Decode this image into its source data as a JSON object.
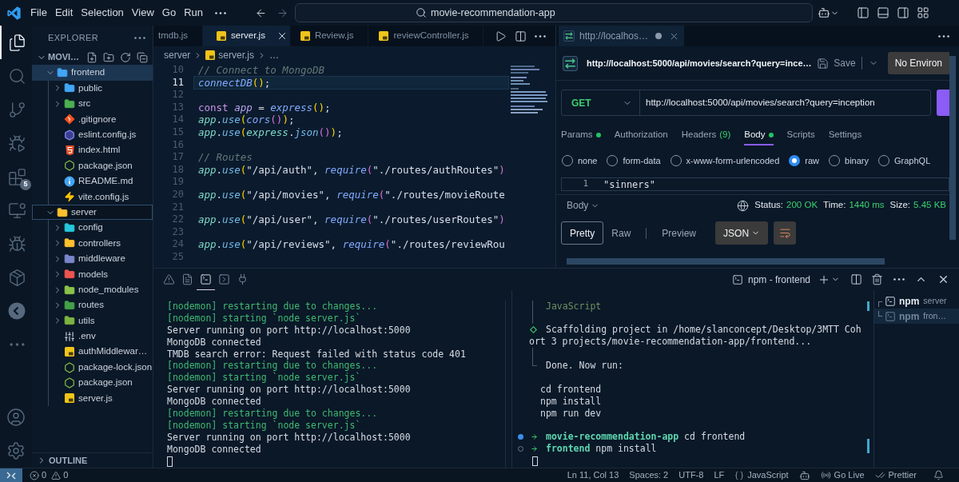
{
  "title_bar": {
    "menu": [
      "File",
      "Edit",
      "Selection",
      "View",
      "Go",
      "Run"
    ],
    "search": "movie-recommendation-app"
  },
  "activity_bar": {
    "items": [
      {
        "kind": "explorer",
        "selected": true
      },
      {
        "kind": "search",
        "selected": false
      },
      {
        "kind": "git",
        "selected": false
      },
      {
        "kind": "debug",
        "selected": false
      },
      {
        "kind": "extensions",
        "selected": false,
        "badge": "5"
      },
      {
        "kind": "remote",
        "selected": false
      },
      {
        "kind": "testing",
        "selected": false
      },
      {
        "kind": "docker",
        "selected": false
      },
      {
        "kind": "thunder",
        "selected": false
      },
      {
        "kind": "more",
        "selected": false
      }
    ]
  },
  "explorer": {
    "title": "EXPLORER",
    "workspace": {
      "label": "MOVI…",
      "expanded": true
    },
    "tree": [
      {
        "kind": "folder",
        "label": "frontend",
        "color": "#42a5f5",
        "expanded": true,
        "selected": true,
        "focused": false,
        "children": [
          {
            "kind": "folder",
            "label": "public",
            "color": "#42a5f5",
            "expanded": false,
            "selected": false
          },
          {
            "kind": "folder",
            "label": "src",
            "color": "#4caf50",
            "expanded": false,
            "selected": false
          },
          {
            "kind": "git",
            "label": ".gitignore",
            "selected": false
          },
          {
            "kind": "eslint",
            "label": "eslint.config.js",
            "selected": false
          },
          {
            "kind": "html",
            "label": "index.html",
            "selected": false
          },
          {
            "kind": "json",
            "label": "package.json",
            "selected": false
          },
          {
            "kind": "info",
            "label": "README.md",
            "selected": false
          },
          {
            "kind": "vite",
            "label": "vite.config.js",
            "selected": false
          }
        ]
      },
      {
        "kind": "folder",
        "label": "server",
        "color": "#fbc02d",
        "expanded": true,
        "selected": false,
        "focused": true,
        "children": [
          {
            "kind": "folder",
            "label": "config",
            "color": "#26c6da",
            "expanded": false,
            "selected": false
          },
          {
            "kind": "folder",
            "label": "controllers",
            "color": "#fbc02d",
            "expanded": false,
            "selected": false
          },
          {
            "kind": "folder",
            "label": "middleware",
            "color": "#7986cb",
            "expanded": false,
            "selected": false
          },
          {
            "kind": "folder",
            "label": "models",
            "color": "#ef5350",
            "expanded": false,
            "selected": false
          },
          {
            "kind": "folder",
            "label": "node_modules",
            "color": "#8bc34a",
            "expanded": false,
            "selected": false
          },
          {
            "kind": "folder",
            "label": "routes",
            "color": "#43a047",
            "expanded": false,
            "selected": false
          },
          {
            "kind": "folder",
            "label": "utils",
            "color": "#7cb342",
            "expanded": false,
            "selected": false
          },
          {
            "kind": "env",
            "label": ".env",
            "selected": false
          },
          {
            "kind": "js",
            "label": "authMiddlewar…",
            "selected": false
          },
          {
            "kind": "json",
            "label": "package-lock.json",
            "selected": false
          },
          {
            "kind": "json",
            "label": "package.json",
            "selected": false
          },
          {
            "kind": "js",
            "label": "server.js",
            "selected": false
          }
        ]
      }
    ],
    "outline": {
      "label": "OUTLINE",
      "expanded": false
    }
  },
  "editor": {
    "tabs": [
      {
        "label": "tmdb.js",
        "icon": false,
        "selected": false
      },
      {
        "label": "server.js",
        "icon": true,
        "selected": true
      },
      {
        "label": "Review.js",
        "icon": true,
        "selected": false
      },
      {
        "label": "reviewController.js",
        "icon": true,
        "selected": false
      }
    ],
    "breadcrumbs": [
      {
        "label": "server",
        "icon": false
      },
      {
        "label": "server.js",
        "icon": true
      },
      {
        "label": "…",
        "icon": false
      }
    ],
    "lines": [
      {
        "number": "10",
        "current": false,
        "tokens": [
          {
            "kind": "comment",
            "text": "// Connect to MongoDB"
          }
        ]
      },
      {
        "number": "11",
        "current": true,
        "tokens": [
          {
            "kind": "function",
            "text": "connectDB"
          },
          {
            "kind": "bracket1",
            "text": "()"
          },
          {
            "kind": "punct",
            "text": ";"
          }
        ]
      },
      {
        "number": "12",
        "current": false
      },
      {
        "number": "13",
        "current": false,
        "tokens": [
          {
            "kind": "keyword",
            "text": "const "
          },
          {
            "kind": "decl",
            "text": "app"
          },
          {
            "kind": "punct",
            "text": " = "
          },
          {
            "kind": "function",
            "text": "express"
          },
          {
            "kind": "bracket1",
            "text": "()"
          },
          {
            "kind": "punct",
            "text": ";"
          }
        ]
      },
      {
        "number": "14",
        "current": false,
        "tokens": [
          {
            "kind": "variable",
            "text": "app"
          },
          {
            "kind": "punct",
            "text": "."
          },
          {
            "kind": "method",
            "text": "use"
          },
          {
            "kind": "bracket1",
            "text": "("
          },
          {
            "kind": "function",
            "text": "cors"
          },
          {
            "kind": "bracket2",
            "text": "()"
          },
          {
            "kind": "bracket1",
            "text": ")"
          },
          {
            "kind": "punct",
            "text": ";"
          }
        ]
      },
      {
        "number": "15",
        "current": false,
        "tokens": [
          {
            "kind": "variable",
            "text": "app"
          },
          {
            "kind": "punct",
            "text": "."
          },
          {
            "kind": "method",
            "text": "use"
          },
          {
            "kind": "bracket1",
            "text": "("
          },
          {
            "kind": "variable",
            "text": "express"
          },
          {
            "kind": "punct",
            "text": "."
          },
          {
            "kind": "method",
            "text": "json"
          },
          {
            "kind": "bracket2",
            "text": "()"
          },
          {
            "kind": "bracket1",
            "text": ")"
          },
          {
            "kind": "punct",
            "text": ";"
          }
        ]
      },
      {
        "number": "16",
        "current": false
      },
      {
        "number": "17",
        "current": false,
        "tokens": [
          {
            "kind": "comment",
            "text": "// Routes"
          }
        ]
      },
      {
        "number": "18",
        "current": false,
        "tokens": [
          {
            "kind": "variable",
            "text": "app"
          },
          {
            "kind": "punct",
            "text": "."
          },
          {
            "kind": "method",
            "text": "use"
          },
          {
            "kind": "bracket1",
            "text": "("
          },
          {
            "kind": "string",
            "text": "\"/api/auth\""
          },
          {
            "kind": "punct",
            "text": ", "
          },
          {
            "kind": "function",
            "text": "require"
          },
          {
            "kind": "bracket2",
            "text": "("
          },
          {
            "kind": "string",
            "text": "\"./routes/authRoutes\""
          },
          {
            "kind": "bracket2",
            "text": ")"
          }
        ]
      },
      {
        "number": "19",
        "current": false
      },
      {
        "number": "20",
        "current": false,
        "tokens": [
          {
            "kind": "variable",
            "text": "app"
          },
          {
            "kind": "punct",
            "text": "."
          },
          {
            "kind": "method",
            "text": "use"
          },
          {
            "kind": "bracket1",
            "text": "("
          },
          {
            "kind": "string",
            "text": "\"/api/movies\""
          },
          {
            "kind": "punct",
            "text": ", "
          },
          {
            "kind": "function",
            "text": "require"
          },
          {
            "kind": "bracket2",
            "text": "("
          },
          {
            "kind": "string",
            "text": "\"./routes/movieRoute"
          }
        ]
      },
      {
        "number": "21",
        "current": false
      },
      {
        "number": "22",
        "current": false,
        "tokens": [
          {
            "kind": "variable",
            "text": "app"
          },
          {
            "kind": "punct",
            "text": "."
          },
          {
            "kind": "method",
            "text": "use"
          },
          {
            "kind": "bracket1",
            "text": "("
          },
          {
            "kind": "string",
            "text": "\"/api/user\""
          },
          {
            "kind": "punct",
            "text": ", "
          },
          {
            "kind": "function",
            "text": "require"
          },
          {
            "kind": "bracket2",
            "text": "("
          },
          {
            "kind": "string",
            "text": "\"./routes/userRoutes\""
          },
          {
            "kind": "bracket2",
            "text": ")"
          }
        ]
      },
      {
        "number": "23",
        "current": false
      },
      {
        "number": "24",
        "current": false,
        "tokens": [
          {
            "kind": "variable",
            "text": "app"
          },
          {
            "kind": "punct",
            "text": "."
          },
          {
            "kind": "method",
            "text": "use"
          },
          {
            "kind": "bracket1",
            "text": "("
          },
          {
            "kind": "string",
            "text": "\"/api/reviews\""
          },
          {
            "kind": "punct",
            "text": ", "
          },
          {
            "kind": "function",
            "text": "require"
          },
          {
            "kind": "bracket2",
            "text": "("
          },
          {
            "kind": "string",
            "text": "\"./routes/reviewRou"
          }
        ]
      },
      {
        "number": "25",
        "current": false
      }
    ]
  },
  "request": {
    "tab": {
      "label": "http://localhos…",
      "modified": true
    },
    "title": "http://localhost:5000/api/movies/search?query=ince…",
    "save": "Save",
    "environment": "No Environ",
    "method": "GET",
    "url": "http://localhost:5000/api/movies/search?query=inception",
    "tabs": [
      {
        "label": "Params",
        "dot": true,
        "selected": false
      },
      {
        "label": "Authorization",
        "dot": false,
        "selected": false
      },
      {
        "label": "Headers",
        "count": "(9)",
        "dot": false,
        "selected": false
      },
      {
        "label": "Body",
        "dot": true,
        "selected": true
      },
      {
        "label": "Scripts",
        "dot": false,
        "selected": false
      },
      {
        "label": "Settings",
        "dot": false,
        "selected": false
      }
    ],
    "body_types": [
      {
        "label": "none",
        "selected": false
      },
      {
        "label": "form-data",
        "selected": false
      },
      {
        "label": "x-www-form-urlencoded",
        "selected": false
      },
      {
        "label": "raw",
        "selected": true
      },
      {
        "label": "binary",
        "selected": false
      },
      {
        "label": "GraphQL",
        "selected": false
      }
    ],
    "body_lines": [
      {
        "number": "1",
        "text": "\"sinners\""
      }
    ],
    "response": {
      "view": "Body",
      "status_label": "Status:",
      "status": "200 OK",
      "time_label": "Time:",
      "time": "1440 ms",
      "size_label": "Size:",
      "size": "5.45 KB"
    },
    "views": [
      {
        "label": "Pretty",
        "selected": true
      },
      {
        "label": "Raw",
        "selected": false
      },
      {
        "label": "Preview",
        "selected": false
      }
    ],
    "format": "JSON"
  },
  "panel": {
    "views": [
      {
        "kind": "problems",
        "selected": false
      },
      {
        "kind": "output",
        "selected": false
      },
      {
        "kind": "terminal",
        "selected": true
      },
      {
        "kind": "debug",
        "selected": false
      },
      {
        "kind": "ports",
        "selected": false
      }
    ],
    "terminal_name": "npm - frontend",
    "server_output": [
      {
        "kind": "nodemon",
        "text": "[nodemon] restarting due to changes..."
      },
      {
        "kind": "nodemon",
        "text": "[nodemon] starting `node server.js`"
      },
      {
        "kind": "log",
        "text": "Server running on port http://localhost:5000"
      },
      {
        "kind": "log",
        "text": "MongoDB connected"
      },
      {
        "kind": "log",
        "text": "TMDB search error: Request failed with status code 401"
      },
      {
        "kind": "nodemon",
        "text": "[nodemon] restarting due to changes..."
      },
      {
        "kind": "nodemon",
        "text": "[nodemon] starting `node server.js`"
      },
      {
        "kind": "log",
        "text": "Server running on port http://localhost:5000"
      },
      {
        "kind": "log",
        "text": "MongoDB connected"
      },
      {
        "kind": "nodemon",
        "text": "[nodemon] restarting due to changes..."
      },
      {
        "kind": "nodemon",
        "text": "[nodemon] starting `node server.js`"
      },
      {
        "kind": "log",
        "text": "Server running on port http://localhost:5000"
      },
      {
        "kind": "log",
        "text": "MongoDB connected"
      }
    ],
    "frontend_output": [
      {
        "kind": "bar",
        "text": "JavaScript"
      },
      {
        "kind": "bar"
      },
      {
        "kind": "step",
        "text": "Scaffolding project in /home/slanconcept/Desktop/3MTT Coh"
      },
      {
        "kind": "wrap",
        "text": "ort 3 projects/movie-recommendation-app/frontend..."
      },
      {
        "kind": "bar"
      },
      {
        "kind": "done",
        "text": "Done. Now run:"
      },
      {
        "kind": "commands",
        "lines": [
          "cd frontend",
          "npm install",
          "npm run dev"
        ]
      },
      {
        "kind": "prompt",
        "finished": true,
        "directory": "movie-recommendation-app",
        "command": "cd frontend"
      },
      {
        "kind": "prompt",
        "finished": false,
        "directory": "frontend",
        "command": "npm install"
      }
    ],
    "terminals": [
      {
        "name": "npm",
        "detail": "server",
        "selected": false
      },
      {
        "name": "npm",
        "detail": "fron…",
        "selected": true
      }
    ]
  },
  "status_bar": {
    "problems": [
      {
        "kind": "errors",
        "count": "0"
      },
      {
        "kind": "warnings",
        "count": "0"
      }
    ],
    "items": [
      {
        "kind": "text",
        "label": "Ln 11, Col 13"
      },
      {
        "kind": "text",
        "label": "Spaces: 2"
      },
      {
        "kind": "text",
        "label": "UTF-8"
      },
      {
        "kind": "text",
        "label": "LF"
      },
      {
        "kind": "language",
        "label": "JavaScript"
      },
      {
        "kind": "copilot"
      },
      {
        "kind": "live",
        "label": "Go Live"
      },
      {
        "kind": "prettier",
        "label": "Prettier"
      },
      {
        "kind": "bell"
      }
    ]
  }
}
